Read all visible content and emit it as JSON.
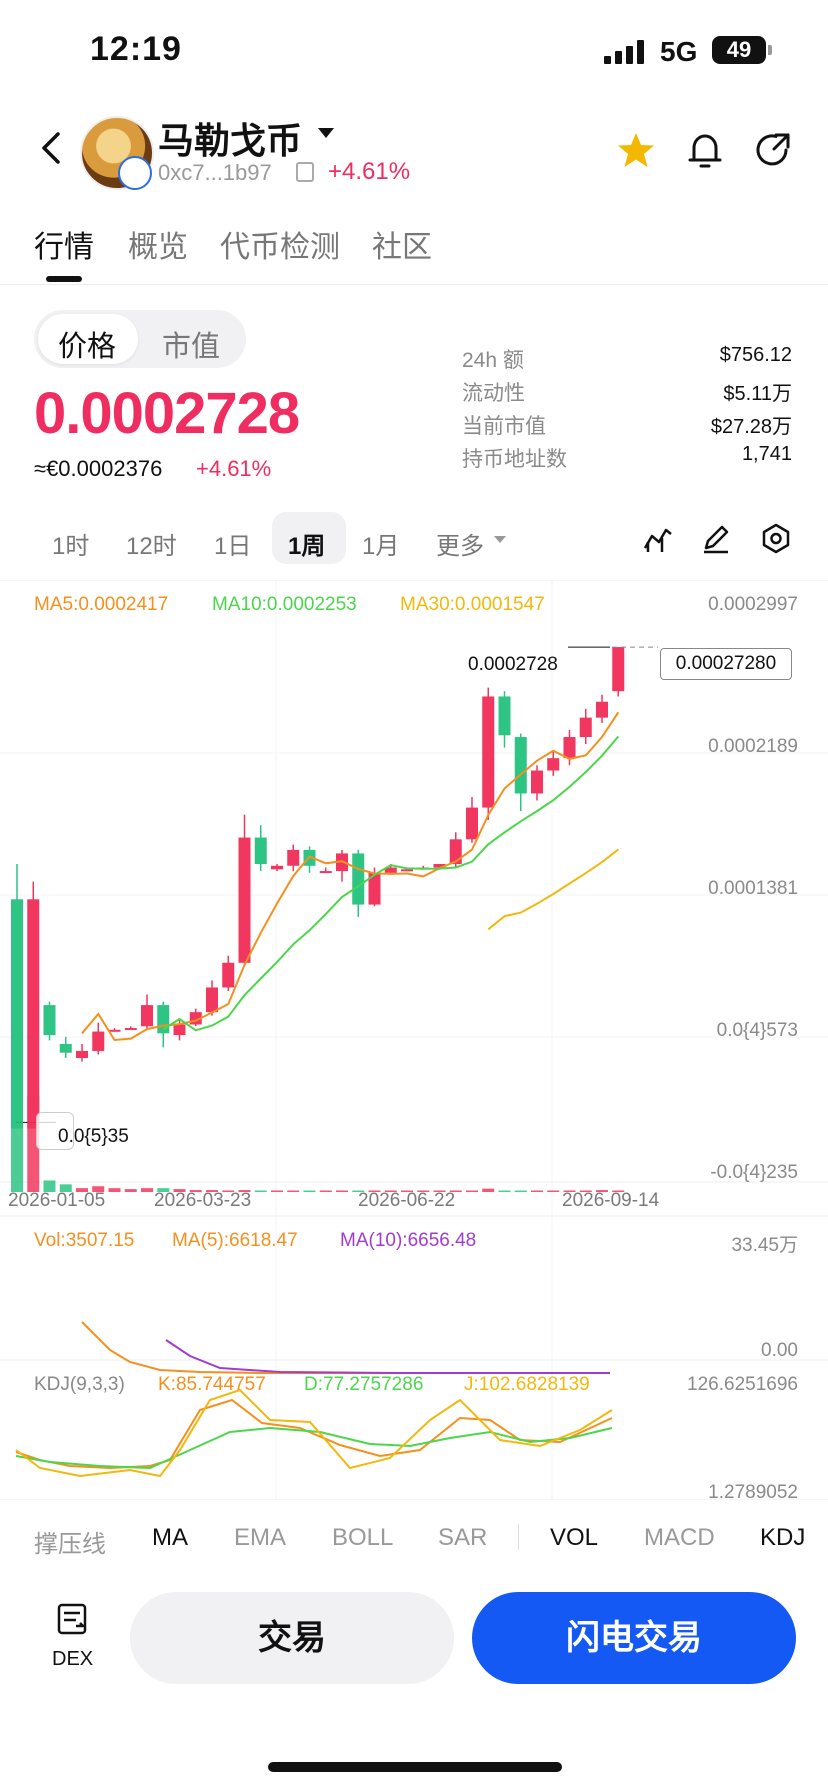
{
  "status_bar": {
    "time": "12:19",
    "network": "5G",
    "battery": "49"
  },
  "header": {
    "token_name": "马勒戈币",
    "address": "0xc7...1b97",
    "change": "+4.61%"
  },
  "tabs": [
    {
      "label": "行情",
      "active": true
    },
    {
      "label": "概览",
      "active": false
    },
    {
      "label": "代币检测",
      "active": false
    },
    {
      "label": "社区",
      "active": false
    }
  ],
  "price_toggle": {
    "price": "价格",
    "market_cap": "市值",
    "selected": "价格"
  },
  "price": {
    "value": "0.0002728",
    "fiat": "≈€0.0002376",
    "change": "+4.61%"
  },
  "stats": [
    {
      "label": "24h  额",
      "value": "$756.12"
    },
    {
      "label": "流动性",
      "value": "$5.11万"
    },
    {
      "label": "当前市值",
      "value": "$27.28万"
    },
    {
      "label": "持币地址数",
      "value": "1,741"
    }
  ],
  "timeframes": [
    {
      "label": "1时",
      "active": false
    },
    {
      "label": "12时",
      "active": false
    },
    {
      "label": "1日",
      "active": false
    },
    {
      "label": "1周",
      "active": true
    },
    {
      "label": "1月",
      "active": false
    },
    {
      "label": "更多",
      "active": false
    }
  ],
  "chart_data": [
    {
      "type": "candlestick",
      "legend": [
        {
          "label": "MA5:0.0002417",
          "color": "#f5901e"
        },
        {
          "label": "MA10:0.0002253",
          "color": "#4cd64c"
        },
        {
          "label": "MA30:0.0001547",
          "color": "#f2b80e"
        }
      ],
      "y_ticks": [
        "0.0002997",
        "0.0002189",
        "0.0001381",
        "0.0{4}573",
        "-0.0{4}235"
      ],
      "x_ticks": [
        "2026-01-05",
        "2026-03-23",
        "2026-06-22",
        "2026-09-14"
      ],
      "last_price": "0.0002728",
      "last_price_box": "0.00027280",
      "low_label": "0.0{5}35",
      "ylim": [
        -2.35e-05,
        0.0002997
      ],
      "candles": [
        [
          0.00013,
          0.0,
          0.00015,
          0.0
        ],
        [
          0.0,
          0.00013,
          0.00014,
          3e-06
        ],
        [
          7e-05,
          5.3e-05,
          7.2e-05,
          5e-05
        ],
        [
          4.8e-05,
          4.3e-05,
          5.2e-05,
          4e-05
        ],
        [
          4e-05,
          4.4e-05,
          4.8e-05,
          3.8e-05
        ],
        [
          4.4e-05,
          5.5e-05,
          6e-05,
          4.2e-05
        ],
        [
          5.6e-05,
          5.6e-05,
          5.7e-05,
          5.5e-05
        ],
        [
          5.7e-05,
          5.7e-05,
          5.8e-05,
          5.6e-05
        ],
        [
          5.8e-05,
          7e-05,
          7.6e-05,
          5.6e-05
        ],
        [
          7e-05,
          5.4e-05,
          7.2e-05,
          4.6e-05
        ],
        [
          5.3e-05,
          5.9e-05,
          6.2e-05,
          5e-05
        ],
        [
          5.9e-05,
          6.6e-05,
          6.8e-05,
          5.8e-05
        ],
        [
          6.6e-05,
          8e-05,
          8.4e-05,
          6.4e-05
        ],
        [
          8e-05,
          9.4e-05,
          9.8e-05,
          7.8e-05
        ],
        [
          9.4e-05,
          0.000165,
          0.000178,
          9.2e-05
        ],
        [
          0.000165,
          0.00015,
          0.000172,
          0.000146
        ],
        [
          0.000147,
          0.000149,
          0.00015,
          0.000146
        ],
        [
          0.000149,
          0.000158,
          0.000161,
          0.000146
        ],
        [
          0.000158,
          0.000149,
          0.00016,
          0.000145
        ],
        [
          0.000146,
          0.000146,
          0.000148,
          0.000145
        ],
        [
          0.000146,
          0.000156,
          0.000158,
          0.00014
        ],
        [
          0.000156,
          0.000127,
          0.000158,
          0.00012
        ],
        [
          0.000127,
          0.000145,
          0.000148,
          0.000126
        ],
        [
          0.000145,
          0.000148,
          0.00015,
          0.000144
        ],
        [
          0.000147,
          0.000147,
          0.000148,
          0.000146
        ],
        [
          0.000148,
          0.000148,
          0.000149,
          0.000147
        ],
        [
          0.000148,
          0.00015,
          0.00015,
          0.000147
        ],
        [
          0.00015,
          0.000164,
          0.000168,
          0.000148
        ],
        [
          0.000164,
          0.000182,
          0.000188,
          0.000162
        ],
        [
          0.000182,
          0.000245,
          0.00025,
          0.000175
        ],
        [
          0.000245,
          0.000223,
          0.000248,
          0.000216
        ],
        [
          0.000222,
          0.00019,
          0.000224,
          0.00018
        ],
        [
          0.00019,
          0.000203,
          0.000206,
          0.000186
        ],
        [
          0.000203,
          0.00021,
          0.000214,
          0.0002
        ],
        [
          0.00021,
          0.000222,
          0.000226,
          0.000206
        ],
        [
          0.000222,
          0.000233,
          0.000238,
          0.000218
        ],
        [
          0.000233,
          0.000242,
          0.000246,
          0.00023
        ],
        [
          0.000248,
          0.000273,
          0.000273,
          0.000245
        ]
      ]
    },
    {
      "type": "bar",
      "legend": [
        {
          "label": "Vol:3507.15",
          "color": "#f5901e"
        },
        {
          "label": "MA(5):6618.47",
          "color": "#f5901e"
        },
        {
          "label": "MA(10):6656.48",
          "color": "#a23bd1"
        }
      ],
      "y_ticks": [
        "33.45万",
        "0.00"
      ]
    },
    {
      "type": "line",
      "legend": [
        {
          "label": "KDJ(9,3,3)",
          "color": "#888888"
        },
        {
          "label": "K:85.744757",
          "color": "#f5901e"
        },
        {
          "label": "D:77.2757286",
          "color": "#4cd64c"
        },
        {
          "label": "J:102.6828139",
          "color": "#f2b80e"
        }
      ],
      "y_ticks": [
        "126.6251696",
        "1.2789052"
      ]
    }
  ],
  "indicators": [
    {
      "label": "撑压线",
      "active": false
    },
    {
      "label": "MA",
      "active": true
    },
    {
      "label": "EMA",
      "active": false
    },
    {
      "label": "BOLL",
      "active": false
    },
    {
      "label": "SAR",
      "active": false
    },
    {
      "label": "VOL",
      "active": true
    },
    {
      "label": "MACD",
      "active": false
    },
    {
      "label": "KDJ",
      "active": true
    }
  ],
  "bottom_bar": {
    "dex_label": "DEX",
    "trade": "交易",
    "flash_trade": "闪电交易"
  },
  "colors": {
    "up": "#f1375f",
    "down": "#2ec484",
    "accent": "#1559f4"
  }
}
